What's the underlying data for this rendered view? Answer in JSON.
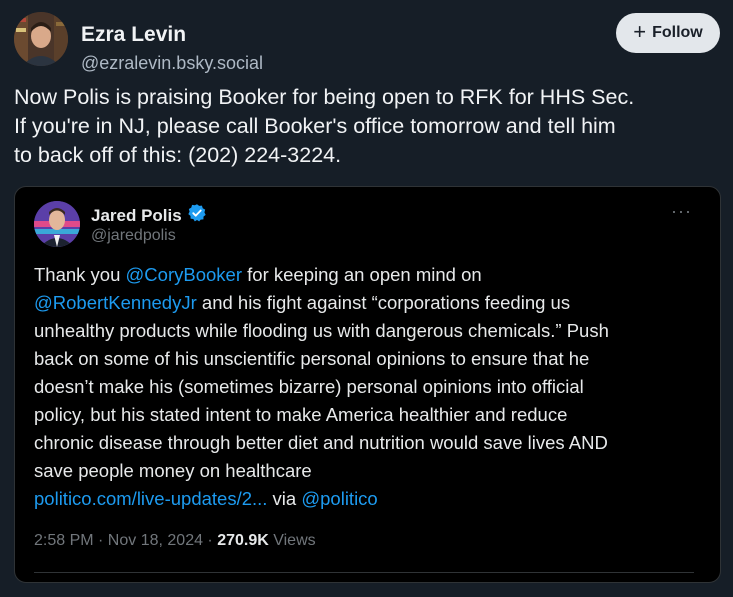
{
  "post": {
    "author_name": "Ezra Levin",
    "author_handle": "@ezralevin.bsky.social",
    "follow_label": "Follow",
    "follow_icon": "+",
    "text_lines": [
      "Now Polis is praising Booker for being open to RFK for HHS Sec.",
      "If you're in NJ, please call Booker's office tomorrow and tell him",
      "to back off of this: (202) 224-3224."
    ]
  },
  "quote": {
    "author_name": "Jared Polis",
    "author_handle": "@jaredpolis",
    "verified_icon": "verified-badge",
    "more_icon": "···",
    "line1_pre": "Thank you ",
    "mention_booker": "@CoryBooker",
    "line1_post": " for keeping an open mind on",
    "mention_rfk": "@RobertKennedyJr",
    "line2_post": " and his fight against “corporations feeding us",
    "lines": [
      "unhealthy products while flooding us with dangerous chemicals.” Push",
      "back on some of his unscientific personal opinions to ensure that he",
      "doesn’t make his (sometimes bizarre) personal opinions into official",
      "policy, but his stated intent to make America healthier and reduce",
      "chronic disease through better diet and nutrition would save lives AND",
      "save people money on healthcare"
    ],
    "link_text": "politico.com/live-updates/2...",
    "via_text": " via ",
    "mention_politico": "@politico",
    "timestamp": "2:58 PM · Nov 18, 2024 · ",
    "views_count": "270.9K",
    "views_label": " Views"
  },
  "colors": {
    "background": "#161e27",
    "link": "#1d9bf0",
    "verified": "#1d9bf0"
  }
}
